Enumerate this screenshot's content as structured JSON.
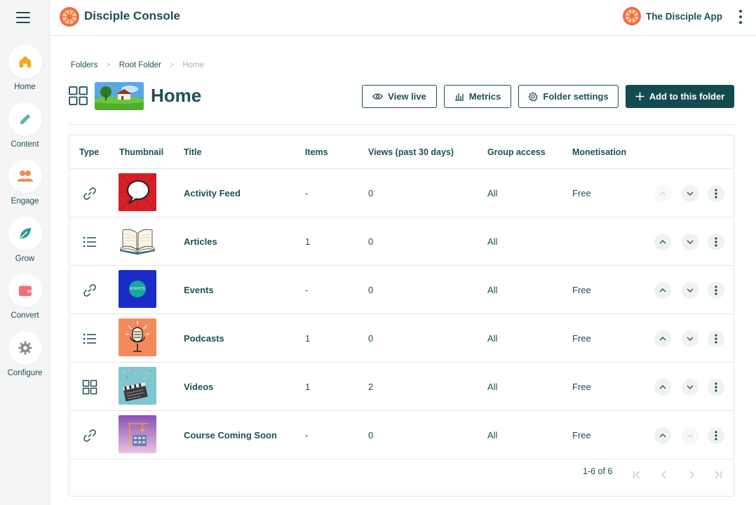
{
  "sidebar": {
    "items": [
      {
        "label": "Home",
        "icon": "home-icon",
        "color": "#f5a623"
      },
      {
        "label": "Content",
        "icon": "pencil-icon",
        "color": "#5bb8a8"
      },
      {
        "label": "Engage",
        "icon": "people-icon",
        "color": "#ef8a5a"
      },
      {
        "label": "Grow",
        "icon": "leaf-icon",
        "color": "#2a9d8f"
      },
      {
        "label": "Convert",
        "icon": "wallet-icon",
        "color": "#ef6f7a"
      },
      {
        "label": "Configure",
        "icon": "gear-icon",
        "color": "#8a8f93"
      }
    ]
  },
  "header": {
    "title": "Disciple Console",
    "app_name": "The Disciple App"
  },
  "breadcrumb": [
    "Folders",
    "Root Folder",
    "Home"
  ],
  "page": {
    "title": "Home",
    "buttons": {
      "view_live": "View live",
      "metrics": "Metrics",
      "folder_settings": "Folder settings",
      "add": "Add to this folder"
    }
  },
  "table": {
    "columns": [
      "Type",
      "Thumbnail",
      "Title",
      "Items",
      "Views (past 30 days)",
      "Group access",
      "Monetisation"
    ],
    "rows": [
      {
        "type": "link",
        "title": "Activity Feed",
        "items": "-",
        "views": "0",
        "access": "All",
        "monetisation": "Free",
        "thumb": "speech-bubble"
      },
      {
        "type": "list",
        "title": "Articles",
        "items": "1",
        "views": "0",
        "access": "All",
        "monetisation": "",
        "thumb": "open-book"
      },
      {
        "type": "link",
        "title": "Events",
        "items": "-",
        "views": "0",
        "access": "All",
        "monetisation": "Free",
        "thumb": "events",
        "thumb_text": "EVENTS"
      },
      {
        "type": "list",
        "title": "Podcasts",
        "items": "1",
        "views": "0",
        "access": "All",
        "monetisation": "Free",
        "thumb": "microphone"
      },
      {
        "type": "grid",
        "title": "Videos",
        "items": "1",
        "views": "2",
        "access": "All",
        "monetisation": "Free",
        "thumb": "clapperboard"
      },
      {
        "type": "link",
        "title": "Course Coming Soon",
        "items": "-",
        "views": "0",
        "access": "All",
        "monetisation": "Free",
        "thumb": "construction"
      }
    ]
  },
  "pagination": {
    "range": "1-6 of 6"
  },
  "colors": {
    "primary": "#1d4f55",
    "primary_button": "#144b51"
  }
}
